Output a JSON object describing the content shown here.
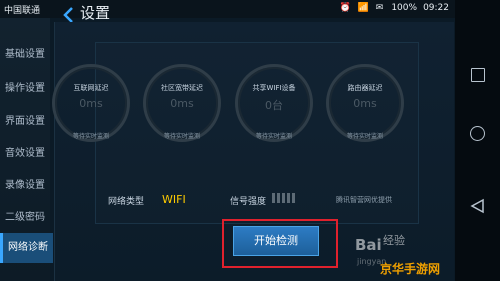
{
  "status": {
    "carrier": "中国联通",
    "battery": "100%",
    "time": "09:22",
    "icons": "⏰ 📶 ✉"
  },
  "header": {
    "title": "设置"
  },
  "sidebar": {
    "items": [
      "基础设置",
      "操作设置",
      "界面设置",
      "音效设置",
      "录像设置",
      "二级密码",
      "网络诊断"
    ],
    "active_index": 6
  },
  "gauges": [
    {
      "label": "互联网延迟",
      "value": "0ms",
      "note": "等待实时监测"
    },
    {
      "label": "社区宽带延迟",
      "value": "0ms",
      "note": "等待实时监测"
    },
    {
      "label": "共享WIFI设备",
      "value": "0台",
      "note": "等待实时监测"
    },
    {
      "label": "路由器延迟",
      "value": "0ms",
      "note": "等待实时监测"
    }
  ],
  "network": {
    "type_label": "网络类型",
    "type_value": "WIFI",
    "signal_label": "信号强度",
    "provider_note": "腾讯智营网优提供"
  },
  "actions": {
    "start_label": "开始检测"
  },
  "watermark": {
    "brand": "Bai",
    "suffix": "经验",
    "domain": "jingyan",
    "site": "京华手游网"
  },
  "colors": {
    "accent": "#3aa7ff",
    "wifi": "#ffcc00",
    "highlight": "#e0212d"
  }
}
